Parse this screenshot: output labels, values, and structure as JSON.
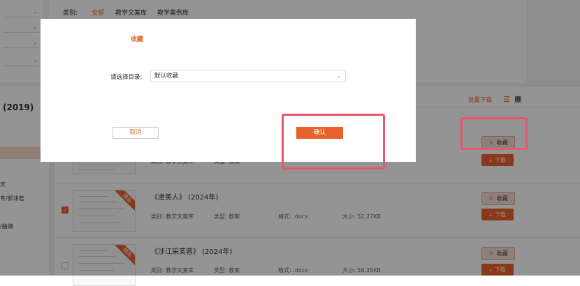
{
  "filter": {
    "category_label": "类别:",
    "tabs": [
      "全部",
      "教学文案库",
      "教学案例库"
    ],
    "active_tab": 0
  },
  "list_header": {
    "left_title": "(2019)",
    "batch_download": "批量下载",
    "view_list_icon": "list-view-icon",
    "view_grid_icon": "grid-view-icon"
  },
  "left_menu": {
    "items": [
      "天",
      "专/郭沫若",
      "/曲婧"
    ]
  },
  "results": [
    {
      "title": "",
      "type_label": "类别:",
      "type_value": "教学文案库",
      "kind_label": "类型:",
      "kind_value": "教案",
      "checked": false
    },
    {
      "title": "《虞美人》 (2024年)",
      "type_label": "类别:",
      "type_value": "教学文案库",
      "kind_label": "类型:",
      "kind_value": "教案",
      "format_label": "格式:",
      "format_value": ".docx",
      "size_label": "大小:",
      "size_value": "52.27KB",
      "ribbon": "精品",
      "checked": true
    },
    {
      "title": "《涉江采芙蓉》 (2024年)",
      "type_label": "类别:",
      "type_value": "教学文案库",
      "kind_label": "类型:",
      "kind_value": "教案",
      "format_label": "格式:",
      "format_value": ".docx",
      "size_label": "大小:",
      "size_value": "59.35KB",
      "ribbon": "精品",
      "checked": false
    }
  ],
  "actions": {
    "favorite": "收藏",
    "download": "下载"
  },
  "modal": {
    "title": "收藏",
    "dir_label": "请选择目录:",
    "dir_value": "默认收藏",
    "cancel": "取消",
    "confirm": "确认"
  },
  "colors": {
    "accent": "#e8632c",
    "highlight": "#e8566a"
  }
}
